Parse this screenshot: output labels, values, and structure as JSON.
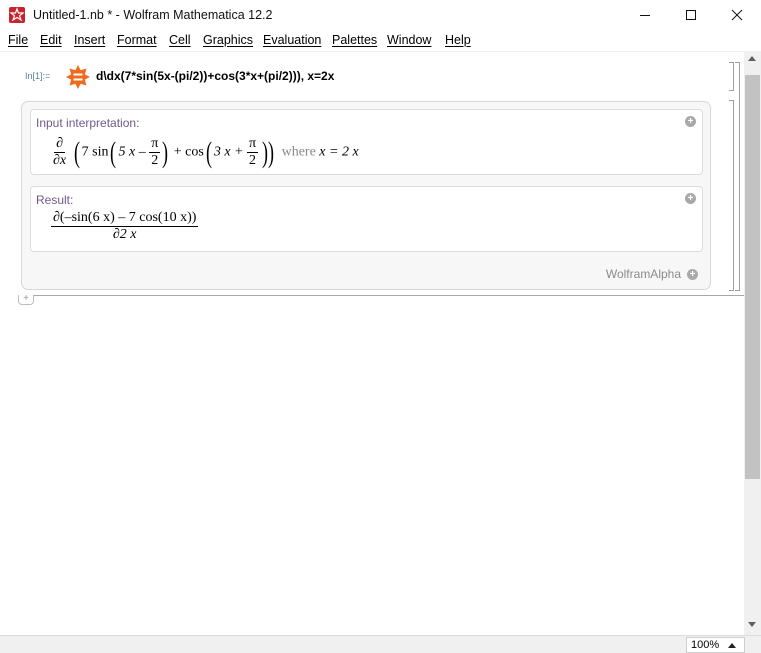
{
  "window": {
    "title": "Untitled-1.nb * - Wolfram Mathematica 12.2",
    "app_icon": "mathematica-spikey-icon",
    "controls": [
      "minimize-icon",
      "maximize-icon",
      "close-icon"
    ]
  },
  "menu": [
    "File",
    "Edit",
    "Insert",
    "Format",
    "Cell",
    "Graphics",
    "Evaluation",
    "Palettes",
    "Window",
    "Help"
  ],
  "notebook": {
    "input_label": "In[1]:=",
    "input_text": "d\\dx(7*sin(5x-(pi/2))+cos(3*x+(pi/2))), x=2x",
    "pods": [
      {
        "title": "Input interpretation:",
        "math": {
          "d": "∂",
          "dx": "∂x",
          "seven_sin": "7 sin",
          "five_x_minus": "5 x –",
          "pi": "π",
          "two": "2",
          "plus_cos": "+ cos",
          "three_x_plus": "3 x +",
          "where": "where",
          "x_eq": "x = 2 x"
        }
      },
      {
        "title": "Result:",
        "math": {
          "numerator": "∂(–sin(6 x) – 7 cos(10 x))",
          "denominator": "∂2 x"
        }
      }
    ],
    "footer": "WolframAlpha"
  },
  "status": {
    "zoom": "100%"
  },
  "colors": {
    "accent_orange": "#f06a1e",
    "pod_title": "#6f5a8a",
    "input_label": "#5b7fa8",
    "brand_red": "#c8242b"
  }
}
